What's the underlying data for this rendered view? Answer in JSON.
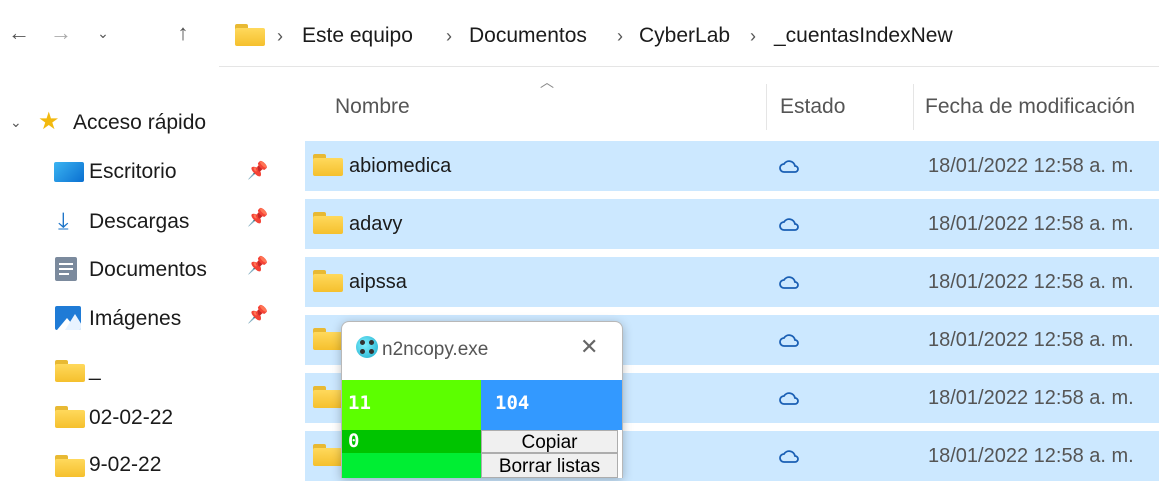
{
  "nav": {
    "back_icon": "arrow-left",
    "forward_icon": "arrow-right",
    "recent_icon": "chevron-down",
    "up_icon": "arrow-up"
  },
  "breadcrumb": [
    "Este equipo",
    "Documentos",
    "CyberLab",
    "_cuentasIndexNew"
  ],
  "sidebar": {
    "quick_access": "Acceso rápido",
    "items": [
      {
        "label": "Escritorio",
        "icon": "desktop-icon",
        "pinned": true
      },
      {
        "label": "Descargas",
        "icon": "download-icon",
        "pinned": true
      },
      {
        "label": "Documentos",
        "icon": "document-icon",
        "pinned": true
      },
      {
        "label": "Imágenes",
        "icon": "pictures-icon",
        "pinned": true
      },
      {
        "label": "_",
        "icon": "folder-icon",
        "pinned": false
      },
      {
        "label": "02-02-22",
        "icon": "folder-icon",
        "pinned": false
      },
      {
        "label": "9-02-22",
        "icon": "folder-icon",
        "pinned": false
      }
    ]
  },
  "columns": {
    "name": "Nombre",
    "status": "Estado",
    "modified": "Fecha de modificación"
  },
  "files": [
    {
      "name": "abiomedica",
      "date": "18/01/2022 12:58 a. m."
    },
    {
      "name": "adavy",
      "date": "18/01/2022 12:58 a. m."
    },
    {
      "name": "aipssa",
      "date": "18/01/2022 12:58 a. m."
    },
    {
      "name": "",
      "date": "18/01/2022 12:58 a. m."
    },
    {
      "name": "",
      "date": "18/01/2022 12:58 a. m."
    },
    {
      "name": "",
      "date": "18/01/2022 12:58 a. m."
    }
  ],
  "popup": {
    "title": "n2ncopy.exe",
    "count_left": "11",
    "count_right": "104",
    "count_zero": "0",
    "copy_label": "Copiar",
    "clear_label": "Borrar listas",
    "colors": {
      "green": "#5cff00",
      "blue": "#3399ff",
      "dark_green": "#00c400",
      "bright_green": "#00ee33"
    }
  }
}
